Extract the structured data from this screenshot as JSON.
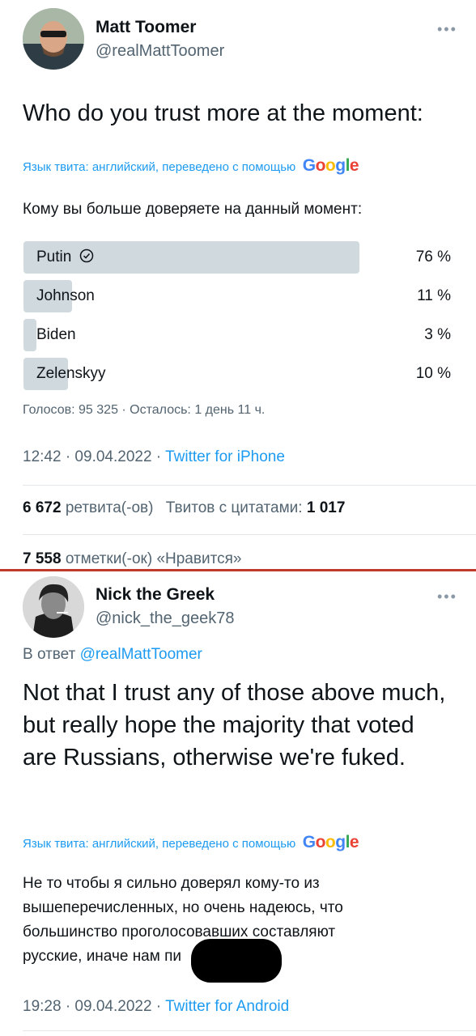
{
  "tweet1": {
    "name": "Matt Toomer",
    "handle": "@realMattToomer",
    "text": "Who do you trust more at the moment:",
    "translate_note": "Язык твита: английский, переведено с помощью",
    "translated": "Кому вы больше доверяете на данный момент:",
    "poll": {
      "options": [
        {
          "label": "Putin",
          "pct_label": "76 %",
          "pct": 76,
          "winner": true
        },
        {
          "label": "Johnson",
          "pct_label": "11 %",
          "pct": 11
        },
        {
          "label": "Biden",
          "pct_label": "3 %",
          "pct": 3
        },
        {
          "label": "Zelenskyy",
          "pct_label": "10 %",
          "pct": 10
        }
      ],
      "summary": "Голосов: 95 325 · Осталось: 1 день 11 ч."
    },
    "time": "12:42 · 09.04.2022 · ",
    "source": "Twitter for iPhone",
    "retweets_num": "6 672",
    "retweets_label": "ретвита(-ов)",
    "quotes_label": "Твитов с цитатами:",
    "quotes_num": "1 017",
    "likes_num": "7 558",
    "likes_label": "отметки(-ок) «Нравится»"
  },
  "tweet2": {
    "name": "Nick the Greek",
    "handle": "@nick_the_geek78",
    "reply_prefix": "В ответ ",
    "reply_to": "@realMattToomer",
    "text": "Not that I trust any of those above much, but really hope the majority that voted are Russians, otherwise we're fuked.",
    "translate_note": "Язык твита: английский, переведено с помощью",
    "translated_lines": [
      "Не то чтобы я сильно доверял кому-то из",
      "вышеперечисленных, но очень надеюсь, что",
      "большинство проголосовавших составляют",
      "русские, иначе нам пи"
    ],
    "time": "19:28 · 09.04.2022 · ",
    "source": "Twitter for Android"
  },
  "google_letters": [
    "G",
    "o",
    "o",
    "g",
    "l",
    "e"
  ],
  "more_glyph": "•••",
  "colors": {
    "accent": "#1d9bf0",
    "poll_bar": "#cfd9de",
    "red_divider": "#c0392b"
  }
}
